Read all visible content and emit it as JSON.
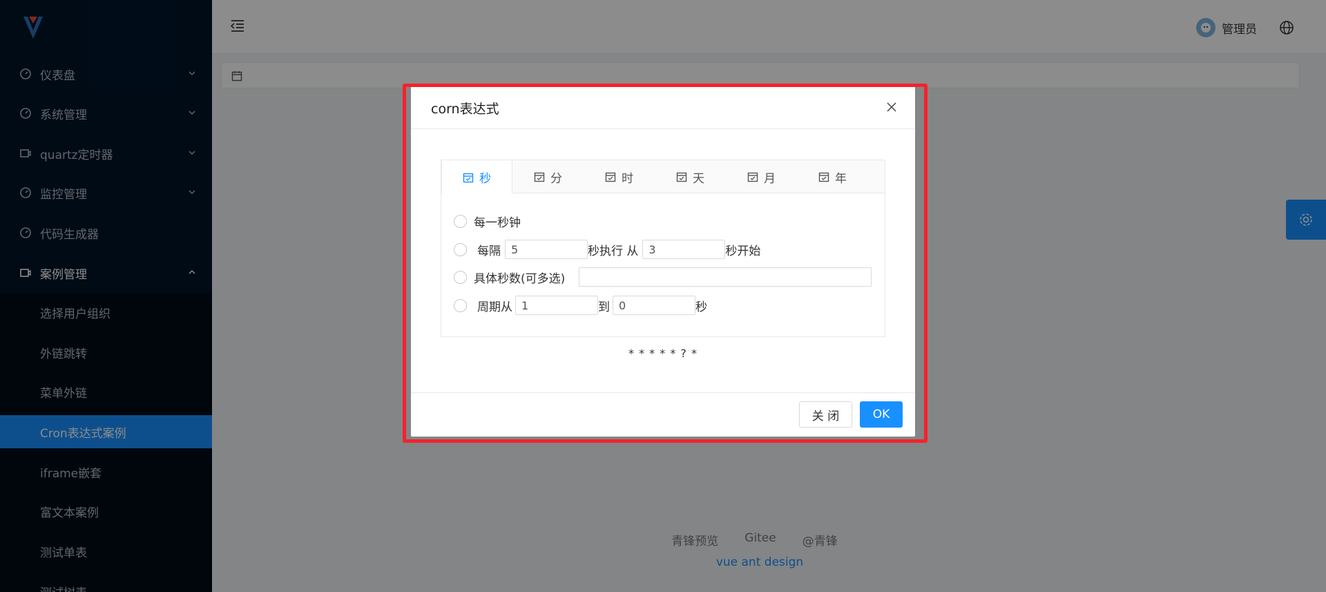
{
  "colors": {
    "sidebar": "#001529",
    "accent": "#1890ff",
    "highlight": "#f5222d"
  },
  "sidebar": {
    "menus": [
      {
        "label": "仪表盘",
        "icon": "dashboard-icon"
      },
      {
        "label": "系统管理",
        "icon": "dashboard-icon"
      },
      {
        "label": "quartz定时器",
        "icon": "video-icon"
      },
      {
        "label": "监控管理",
        "icon": "dashboard-icon"
      },
      {
        "label": "代码生成器",
        "icon": "dashboard-icon"
      },
      {
        "label": "案例管理",
        "icon": "video-icon"
      }
    ],
    "submenu": [
      {
        "label": "选择用户组织"
      },
      {
        "label": "外链跳转"
      },
      {
        "label": "菜单外链"
      },
      {
        "label": "Cron表达式案例"
      },
      {
        "label": "iframe嵌套"
      },
      {
        "label": "富文本案例"
      },
      {
        "label": "测试单表"
      },
      {
        "label": "测试树表"
      }
    ]
  },
  "header": {
    "user_name": "管理员"
  },
  "footer": {
    "links": [
      "青锋预览",
      "Gitee",
      "@青锋"
    ],
    "sub": "vue ant design"
  },
  "modal": {
    "title": "corn表达式",
    "tabs": [
      "秒",
      "分",
      "时",
      "天",
      "月",
      "年"
    ],
    "active_tab": "秒",
    "options": {
      "every": "每一秒钟",
      "interval_prefix": "每隔",
      "interval_value": "5",
      "interval_mid": "秒执行 从",
      "interval_start": "3",
      "interval_suffix": "秒开始",
      "specific": "具体秒数(可多选)",
      "specific_value": "",
      "cycle_prefix": "周期从",
      "cycle_from": "1",
      "cycle_mid": "到",
      "cycle_to": "0",
      "cycle_suffix": "秒"
    },
    "expression": "* * * * * ? *",
    "close_label": "关 闭",
    "ok_label": "OK"
  }
}
